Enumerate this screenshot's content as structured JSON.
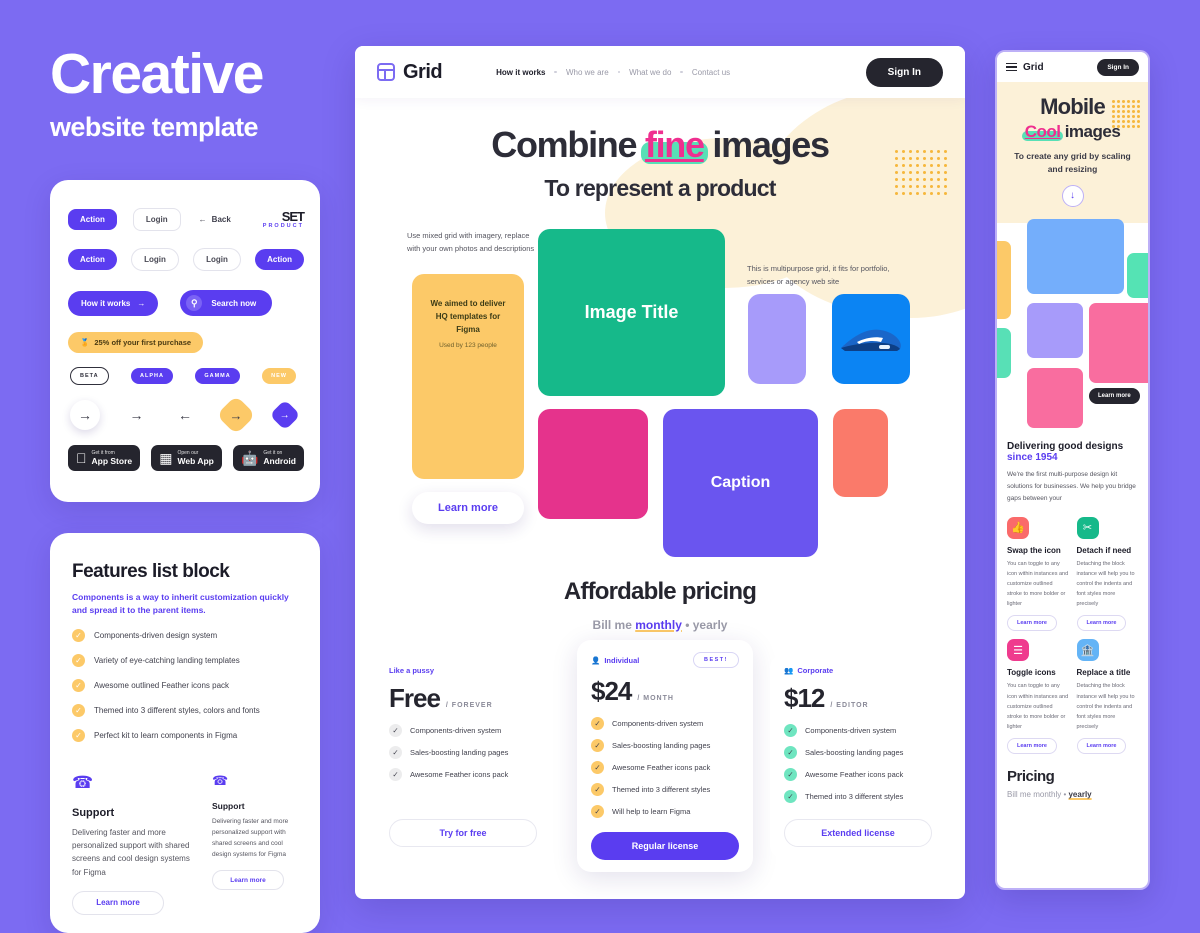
{
  "hero": {
    "title": "Creative",
    "subtitle": "website template"
  },
  "components_card": {
    "row1": [
      {
        "label": "Action",
        "style": "purple"
      },
      {
        "label": "Login",
        "style": "white"
      },
      {
        "label": "Back",
        "style": "ghost",
        "icon": "arrow-left-icon"
      }
    ],
    "logo": {
      "word": "SET",
      "sub": "PRODUCT"
    },
    "row2": [
      {
        "label": "Action",
        "style": "purple"
      },
      {
        "label": "Login",
        "style": "white"
      },
      {
        "label": "Login",
        "style": "white"
      },
      {
        "label": "Action",
        "style": "purple"
      }
    ],
    "row3": [
      {
        "label": "How it works",
        "icon": "arrow-right-icon"
      },
      {
        "label": "Search now",
        "icon": "search-icon"
      }
    ],
    "promo": {
      "icon": "medal-icon",
      "label": "25% off your first purchase"
    },
    "tags": [
      {
        "label": "BETA",
        "style": "outline"
      },
      {
        "label": "ALPHA",
        "style": "purple"
      },
      {
        "label": "GAMMA",
        "style": "purple"
      },
      {
        "label": "NEW",
        "style": "yellow"
      }
    ],
    "arrows": [
      "arrow-right-icon",
      "arrow-right-icon",
      "arrow-left-icon",
      "arrow-right-icon",
      "arrow-right-icon"
    ],
    "stores": [
      {
        "top": "Get it from",
        "bottom": "App Store",
        "icon": "apple-icon"
      },
      {
        "top": "Open our",
        "bottom": "Web App",
        "icon": "window-icon"
      },
      {
        "top": "Get it on",
        "bottom": "Android",
        "icon": "android-icon"
      }
    ]
  },
  "features_card": {
    "title": "Features list block",
    "description": "Components is a way to inherit customization quickly and spread it to the parent items.",
    "items": [
      "Components-driven design system",
      "Variety of eye-catching landing templates",
      "Awesome outlined Feather icons pack",
      "Themed into 3 different styles, colors and fonts",
      "Perfect kit to learn components in Figma"
    ],
    "support_left": {
      "icon": "phone-call-icon",
      "title": "Support",
      "body": "Delivering faster and more personalized support with shared screens and cool design systems for Figma",
      "button": "Learn more"
    },
    "support_right": {
      "icon": "phone-call-icon",
      "title": "Support",
      "body": "Delivering faster and more personalized support with shared screens and cool design systems for Figma",
      "button": "Learn more"
    }
  },
  "desktop": {
    "nav": {
      "brand": "Grid",
      "brand_icon": "layout-grid-icon",
      "links": [
        "How it works",
        "Who we are",
        "What we do",
        "Contact us"
      ],
      "signin": "Sign In"
    },
    "hero": {
      "line1_pre": "Combine ",
      "line1_hl": "fine",
      "line1_post": " images",
      "line2": "To represent a product"
    },
    "grid": {
      "note_left": "Use mixed grid with imagery, replace with your own photos and descriptions",
      "note_right": "This is multipurpose grid, it fits for portfolio, services or agency web site",
      "yellow_card_title": "We aimed to deliver HQ templates for Figma",
      "yellow_card_sub": "Used by 123 people",
      "learn_more": "Learn more",
      "image_title": "Image Title",
      "caption": "Caption"
    },
    "pricing": {
      "title": "Affordable pricing",
      "sub_pre": "Bill me ",
      "sub_sel": "monthly",
      "sub_post": " • yearly",
      "plans": [
        {
          "kicker": "Like a pussy",
          "kicker_icon": "",
          "price": "Free",
          "per": "/ FOREVER",
          "badge": "",
          "features": [
            "Components-driven system",
            "Sales-boosting landing pages",
            "Awesome Feather icons pack"
          ],
          "check_style": "grey",
          "button": "Try for free",
          "button_style": "ghost"
        },
        {
          "kicker": "Individual",
          "kicker_icon": "user-icon",
          "price": "$24",
          "per": "/ MONTH",
          "badge": "BEST!",
          "features": [
            "Components-driven system",
            "Sales-boosting landing pages",
            "Awesome Feather icons pack",
            "Themed into 3 different styles",
            "Will help to learn Figma"
          ],
          "check_style": "yellow",
          "button": "Regular license",
          "button_style": "solid"
        },
        {
          "kicker": "Corporate",
          "kicker_icon": "users-icon",
          "price": "$12",
          "per": "/ EDITOR",
          "badge": "",
          "features": [
            "Components-driven system",
            "Sales-boosting landing pages",
            "Awesome Feather icons pack",
            "Themed into 3 different styles"
          ],
          "check_style": "green",
          "button": "Extended license",
          "button_style": "ghost"
        }
      ]
    }
  },
  "mobile": {
    "nav": {
      "menu_icon": "hamburger-icon",
      "brand": "Grid",
      "signin": "Sign In"
    },
    "hero": {
      "line1": "Mobile",
      "line2_hl": "Cool",
      "line2_post": " images",
      "sub": "To create any grid by scaling and resizing",
      "down_icon": "arrow-down-icon"
    },
    "grid": {
      "learn_more": "Learn more"
    },
    "about": {
      "title": "Delivering good designs",
      "accent": "since 1954",
      "body": "We're the first multi-purpose design kit solutions for businesses. We help you bridge gaps between    your"
    },
    "cards": [
      {
        "icon": "thumbs-up-icon",
        "icon_color": "#fa6a6a",
        "title": "Swap the icon",
        "body": "You can toggle to any icon within instances and customize outlined stroke to more bolder or lighter",
        "button": "Learn more"
      },
      {
        "icon": "scissors-icon",
        "icon_color": "#16b98a",
        "title": "Detach if need",
        "body": "Detaching the block instance will help you to control the indents and font styles more precisely",
        "button": "Learn more"
      },
      {
        "icon": "toggle-icon",
        "icon_color": "#ef3b8e",
        "title": "Toggle icons",
        "body": "You can toggle to any icon within instances and customize outlined stroke to more bolder or lighter",
        "button": "Learn more"
      },
      {
        "icon": "bank-icon",
        "icon_color": "#64b4f6",
        "title": "Replace a title",
        "body": "Detaching the block instance will help you to control the indents and font styles more precisely",
        "button": "Learn more"
      }
    ],
    "pricing": {
      "title": "Pricing",
      "sub_pre": "Bill me monthly • ",
      "sub_sel": "yearly"
    }
  },
  "colors": {
    "background": "#7c6bf2",
    "purple": "#5a3df0",
    "yellow": "#fcc968",
    "green": "#16b98a",
    "pink": "#e5338c",
    "coral": "#fa6a6a",
    "mint": "#58e0b6",
    "cream": "#fcf1d8",
    "dark": "#25252e"
  }
}
